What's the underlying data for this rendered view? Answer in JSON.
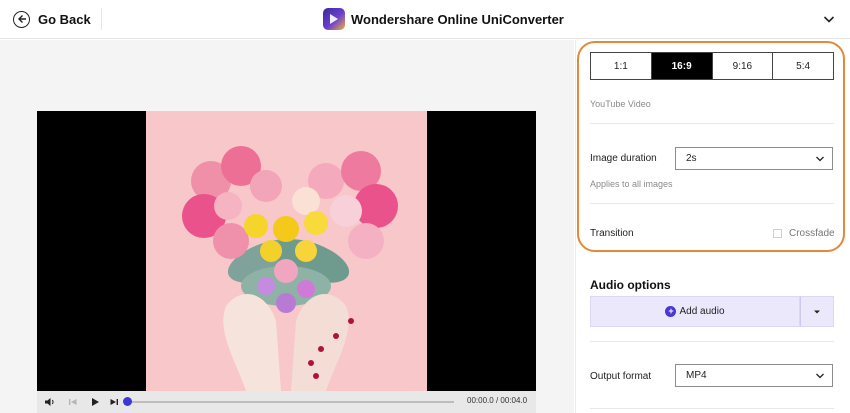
{
  "header": {
    "back_label": "Go Back",
    "brand_name": "Wondershare Online UniConverter"
  },
  "player": {
    "time_current": "00:00.0",
    "time_separator": "/",
    "time_total": "00:04.0"
  },
  "aspect": {
    "ratios": [
      "1:1",
      "16:9",
      "9:16",
      "5:4"
    ],
    "selected": "16:9",
    "caption": "YouTube Video"
  },
  "image_duration": {
    "label": "Image duration",
    "value": "2s",
    "hint": "Applies to all images"
  },
  "transition": {
    "label": "Transition",
    "crossfade_label": "Crossfade",
    "crossfade_checked": false
  },
  "audio": {
    "section_title": "Audio options",
    "add_label": "Add audio"
  },
  "output": {
    "label": "Output format",
    "value": "MP4"
  },
  "colors": {
    "accent": "#4b36d6",
    "highlight": "#e08a3a",
    "active_ratio": "#000000"
  }
}
